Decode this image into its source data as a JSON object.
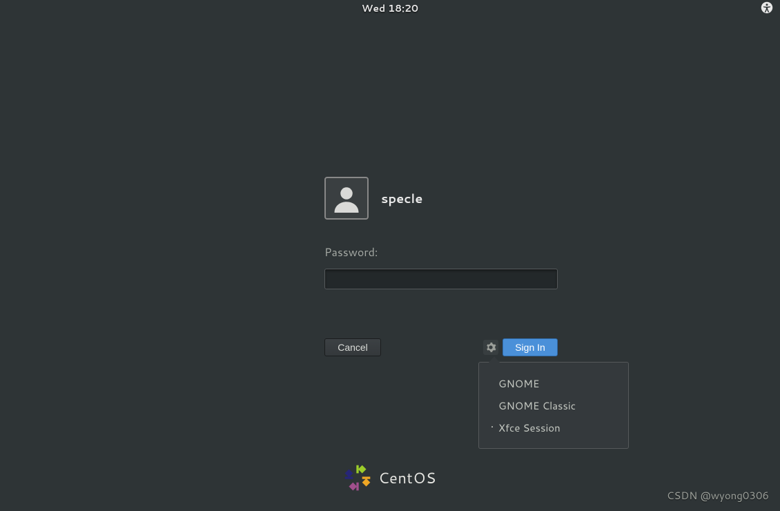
{
  "topbar": {
    "datetime": "Wed 18:20",
    "a11y_icon": "accessibility-icon"
  },
  "login": {
    "username": "specle",
    "password_label": "Password:",
    "password_value": "",
    "cancel_label": "Cancel",
    "signin_label": "Sign In"
  },
  "session_menu": {
    "items": [
      {
        "label": "GNOME",
        "selected": false
      },
      {
        "label": "GNOME Classic",
        "selected": false
      },
      {
        "label": "Xfce Session",
        "selected": true
      }
    ]
  },
  "brand": {
    "name": "CentOS"
  },
  "watermark": "CSDN @wyong0306"
}
